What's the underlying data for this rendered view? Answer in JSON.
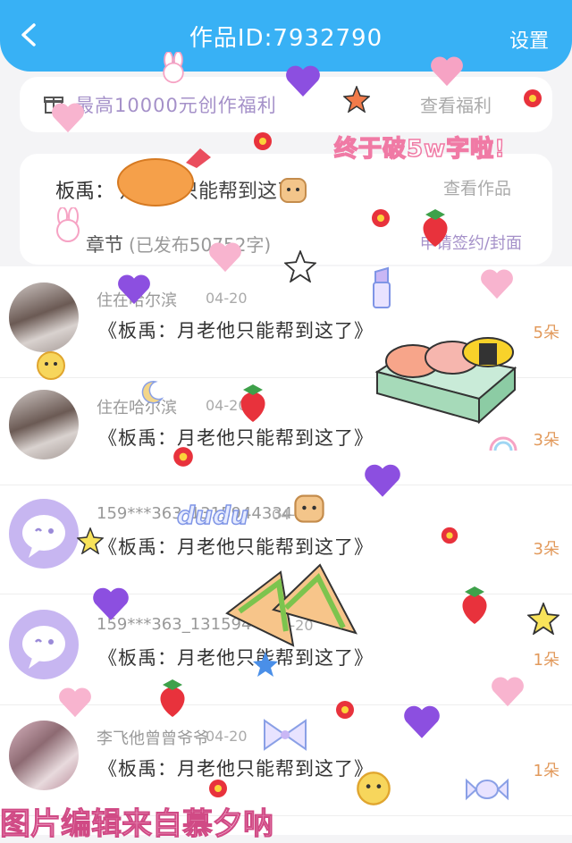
{
  "header": {
    "title": "作品ID:7932790",
    "settings_label": "设置"
  },
  "benefit": {
    "text": "最高10000元创作福利",
    "link": "查看福利"
  },
  "work": {
    "label": "板禹：",
    "title": "月老他只能帮到这了",
    "link": "查看作品",
    "chapter_label": "章节",
    "chapter_info": "(已发布50752字)",
    "contract_link": "申请签约/封面"
  },
  "comments": [
    {
      "user": "住在哈尔滨",
      "date": "04-20",
      "text": "《板禹：月老他只能帮到这了》",
      "count": "5朵",
      "avatar": "photo"
    },
    {
      "user": "住在哈尔滨",
      "date": "04-20",
      "text": "《板禹：月老他只能帮到这了》",
      "count": "3朵",
      "avatar": "photo"
    },
    {
      "user": "159***363_1315944334",
      "date": "04-20",
      "text": "《板禹：月老他只能帮到这了》",
      "count": "3朵",
      "avatar": "default"
    },
    {
      "user": "159***363_1315944334",
      "date": "04-20",
      "text": "《板禹：月老他只能帮到这了》",
      "count": "1朵",
      "avatar": "default"
    },
    {
      "user": "李飞他曾曾爷爷",
      "date": "04-20",
      "text": "《板禹：月老他只能帮到这了》",
      "count": "1朵",
      "avatar": "photo2"
    }
  ],
  "overlay": {
    "banner": "终于破5w字啦!",
    "dudu": "dudu",
    "credit": "图片编辑来自慕夕呐"
  },
  "colors": {
    "header": "#38b1f5",
    "accent_purple": "#a591c9",
    "count_orange": "#e29a5c"
  }
}
